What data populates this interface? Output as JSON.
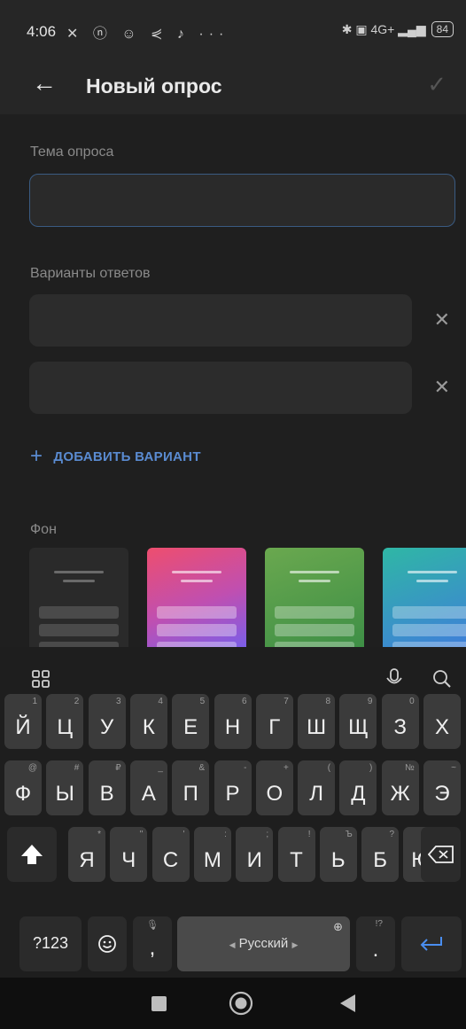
{
  "status_bar": {
    "time": "4:06",
    "left_icons": "✕ ⓝ ☺ ⋞ ♪ ···",
    "right_icons": "✱ ▣ 4G+ ▂▄▆",
    "battery": "84"
  },
  "appbar": {
    "title": "Новый опрос",
    "back_icon": "arrow-left",
    "confirm_icon": "check"
  },
  "form": {
    "topic_label": "Тема опроса",
    "topic_value": "",
    "options_label": "Варианты ответов",
    "options": [
      {
        "value": ""
      },
      {
        "value": ""
      }
    ],
    "add_option_label": "ДОБАВИТЬ ВАРИАНТ",
    "background_label": "Фон",
    "backgrounds": [
      {
        "name": "dark"
      },
      {
        "name": "pink-purple"
      },
      {
        "name": "green"
      },
      {
        "name": "teal-blue"
      }
    ]
  },
  "keyboard": {
    "language": "Русский",
    "row1": [
      {
        "k": "Й",
        "h": "1"
      },
      {
        "k": "Ц",
        "h": "2"
      },
      {
        "k": "У",
        "h": "3"
      },
      {
        "k": "К",
        "h": "4"
      },
      {
        "k": "Е",
        "h": "5"
      },
      {
        "k": "Н",
        "h": "6"
      },
      {
        "k": "Г",
        "h": "7"
      },
      {
        "k": "Ш",
        "h": "8"
      },
      {
        "k": "Щ",
        "h": "9"
      },
      {
        "k": "З",
        "h": "0"
      },
      {
        "k": "Х",
        "h": ""
      }
    ],
    "row2": [
      {
        "k": "Ф",
        "h": "@"
      },
      {
        "k": "Ы",
        "h": "#"
      },
      {
        "k": "В",
        "h": "₽"
      },
      {
        "k": "А",
        "h": "_"
      },
      {
        "k": "П",
        "h": "&"
      },
      {
        "k": "Р",
        "h": "-"
      },
      {
        "k": "О",
        "h": "+"
      },
      {
        "k": "Л",
        "h": "("
      },
      {
        "k": "Д",
        "h": ")"
      },
      {
        "k": "Ж",
        "h": "№"
      },
      {
        "k": "Э",
        "h": "~"
      }
    ],
    "row3": [
      {
        "k": "Я",
        "h": "*"
      },
      {
        "k": "Ч",
        "h": "\""
      },
      {
        "k": "С",
        "h": "'"
      },
      {
        "k": "М",
        "h": ":"
      },
      {
        "k": "И",
        "h": ";"
      },
      {
        "k": "Т",
        "h": "!"
      },
      {
        "k": "Ь",
        "h": "Ъ"
      },
      {
        "k": "Б",
        "h": "?"
      },
      {
        "k": "Ю",
        "h": "%"
      }
    ],
    "symbols_key": "?123",
    "comma": ",",
    "comma_hint": "🎙",
    "period": ".",
    "period_hint": "!?"
  }
}
